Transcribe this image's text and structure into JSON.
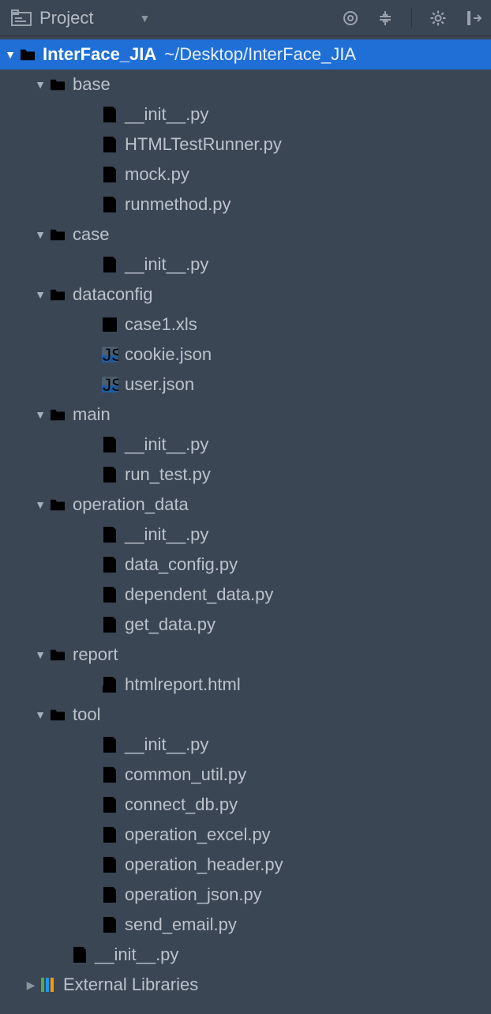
{
  "toolbar": {
    "title": "Project"
  },
  "root": {
    "name": "InterFace_JIA",
    "path": "~/Desktop/InterFace_JIA"
  },
  "tree": {
    "base": {
      "label": "base",
      "files": [
        "__init__.py",
        "HTMLTestRunner.py",
        "mock.py",
        "runmethod.py"
      ]
    },
    "case": {
      "label": "case",
      "files": [
        "__init__.py"
      ]
    },
    "dataconfig": {
      "label": "dataconfig",
      "files": [
        "case1.xls",
        "cookie.json",
        "user.json"
      ]
    },
    "main": {
      "label": "main",
      "files": [
        "__init__.py",
        "run_test.py"
      ]
    },
    "operation_data": {
      "label": "operation_data",
      "files": [
        "__init__.py",
        "data_config.py",
        "dependent_data.py",
        "get_data.py"
      ]
    },
    "report": {
      "label": "report",
      "files": [
        "htmlreport.html"
      ]
    },
    "tool": {
      "label": "tool",
      "files": [
        "__init__.py",
        "common_util.py",
        "connect_db.py",
        "operation_excel.py",
        "operation_header.py",
        "operation_json.py",
        "send_email.py"
      ]
    },
    "root_init": "__init__.py"
  },
  "external": "External Libraries"
}
